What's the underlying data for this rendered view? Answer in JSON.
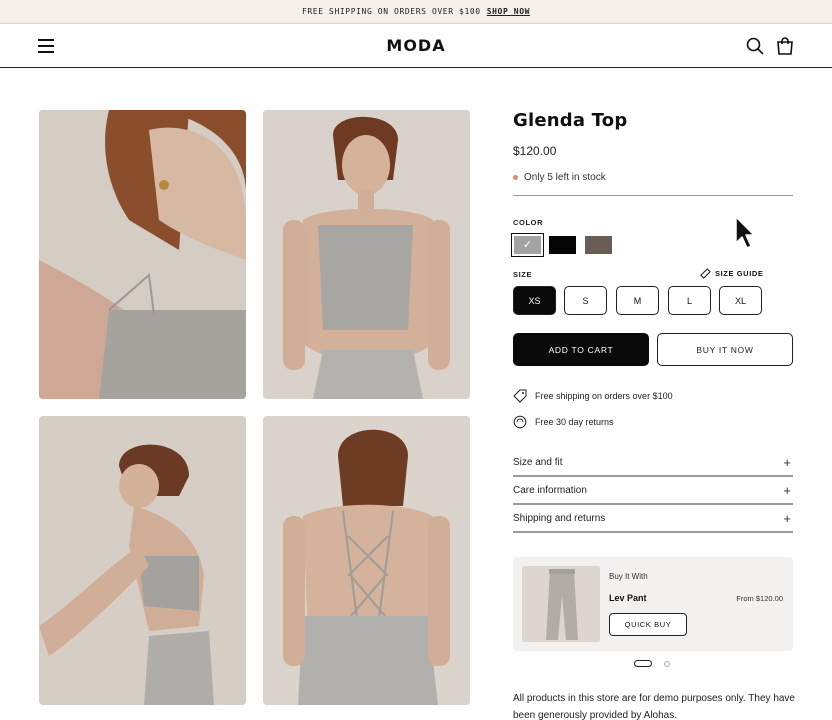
{
  "announcement": {
    "text": "FREE SHIPPING ON ORDERS OVER $100",
    "link": "SHOP NOW"
  },
  "header": {
    "logo": "MODA",
    "icons": [
      "menu-icon",
      "search-icon",
      "bag-icon"
    ]
  },
  "product": {
    "title": "Glenda Top",
    "price": "$120.00",
    "stock": "Only 5 left in stock",
    "color_label": "COLOR",
    "colors": [
      {
        "name": "grey",
        "hex": "#a3a3a3",
        "selected": true
      },
      {
        "name": "black",
        "hex": "#050505",
        "selected": false
      },
      {
        "name": "taupe",
        "hex": "#6a5d56",
        "selected": false
      }
    ],
    "size_label": "SIZE",
    "size_guide": "SIZE GUIDE",
    "sizes": [
      "XS",
      "S",
      "M",
      "L",
      "XL"
    ],
    "selected_size": "XS",
    "add_to_cart": "ADD TO CART",
    "buy_now": "BUY IT NOW"
  },
  "perks": [
    {
      "icon": "shipping-tag-icon",
      "text": "Free shipping on orders over $100"
    },
    {
      "icon": "returns-icon",
      "text": "Free 30 day returns"
    }
  ],
  "accordion": [
    "Size and fit",
    "Care information",
    "Shipping and returns"
  ],
  "bundle": {
    "kicker": "Buy It With",
    "name": "Lev Pant",
    "price": "From $120.00",
    "button": "QUICK BUY"
  },
  "carousel": {
    "slides": 2,
    "active": 1
  },
  "note": "All products in this store are for demo purposes only. They have been generously provided by Alohas.",
  "colors": {
    "accent": "#0a0a0a",
    "announce_bg": "#f6f0ea",
    "stock_dot": "#d88f6a",
    "bundle_bg": "#f3f1ef"
  }
}
